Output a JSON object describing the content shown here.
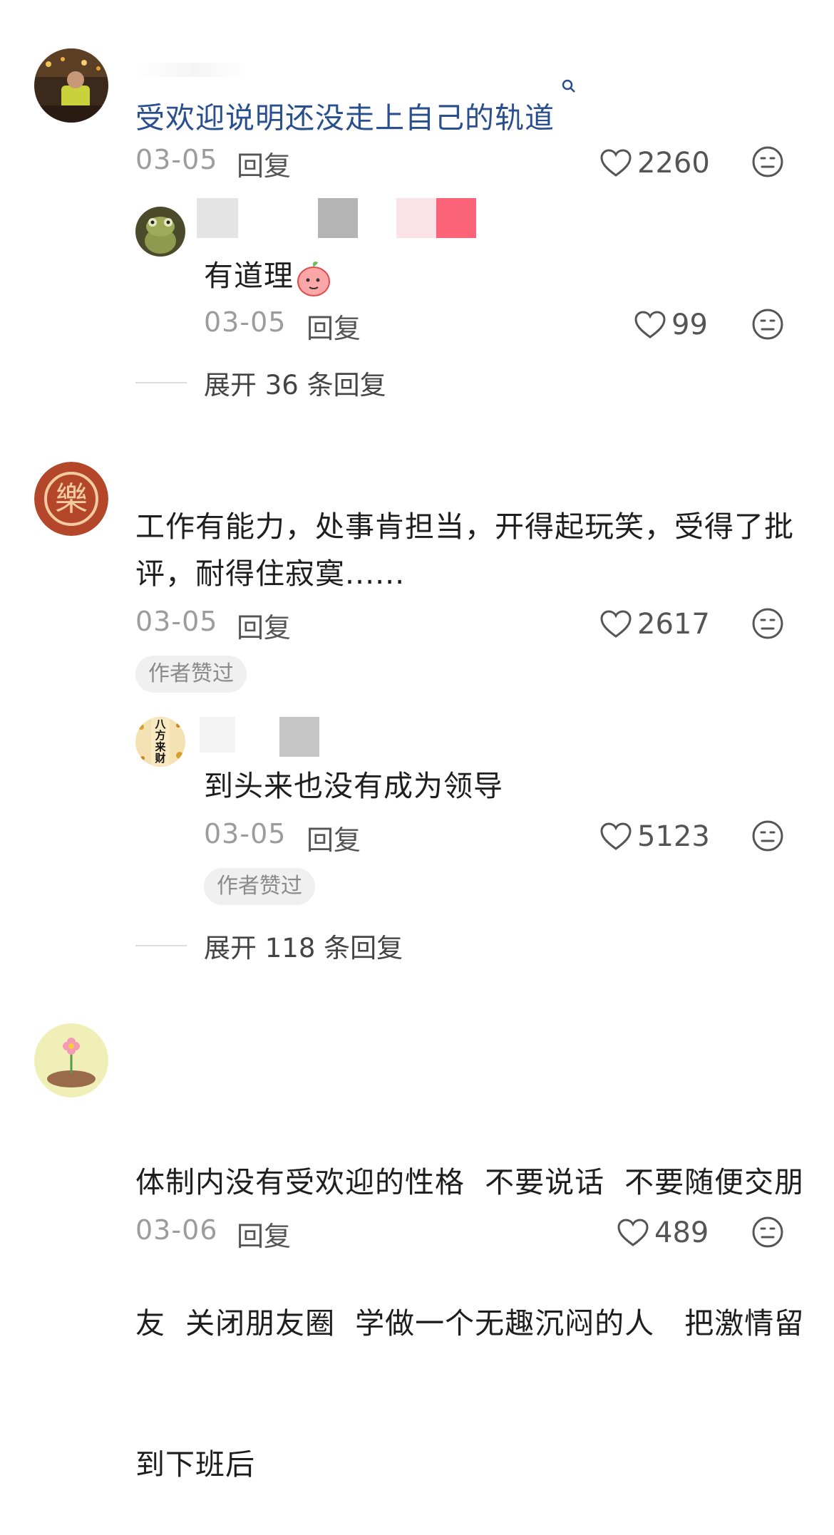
{
  "comments": [
    {
      "avatar_icon": "man-photo-avatar",
      "text_line1": "受欢迎说明还没走上自己的轨道",
      "date": "03-05",
      "reply": "回复",
      "likes": "2260",
      "replies": [
        {
          "avatar_icon": "frog-avatar",
          "text": "有道理",
          "emoji_icon": "peach-face-emoji",
          "date": "03-05",
          "reply": "回复",
          "likes": "99"
        }
      ],
      "expand": "展开 36 条回复"
    },
    {
      "avatar_icon": "le-character-avatar",
      "text_line1": "工作有能力，处事肯担当，开得起玩笑，受得了批",
      "text_line2": "评，耐得住寂寞......",
      "date": "03-05",
      "reply": "回复",
      "likes": "2617",
      "badge": "作者赞过",
      "replies": [
        {
          "avatar_icon": "fortune-avatar",
          "avatar_text": "八方来财",
          "text": "到头来也没有成为领导",
          "date": "03-05",
          "reply": "回复",
          "likes": "5123",
          "badge": "作者赞过"
        }
      ],
      "expand": "展开 118 条回复"
    },
    {
      "avatar_icon": "flower-avatar",
      "text_line1": "体制内没有受欢迎的性格  不要说话  不要随便交朋",
      "text_line2": "友  关闭朋友圈  学做一个无趣沉闷的人   把激情留",
      "text_line3": "到下班后",
      "date": "03-06",
      "reply": "回复",
      "likes": "489"
    }
  ],
  "avatar_le_char": "樂",
  "colors": {
    "link_text": "#2a4f8f",
    "meta_gray": "#9c9c9c",
    "badge_bg": "#f0f0f0"
  }
}
